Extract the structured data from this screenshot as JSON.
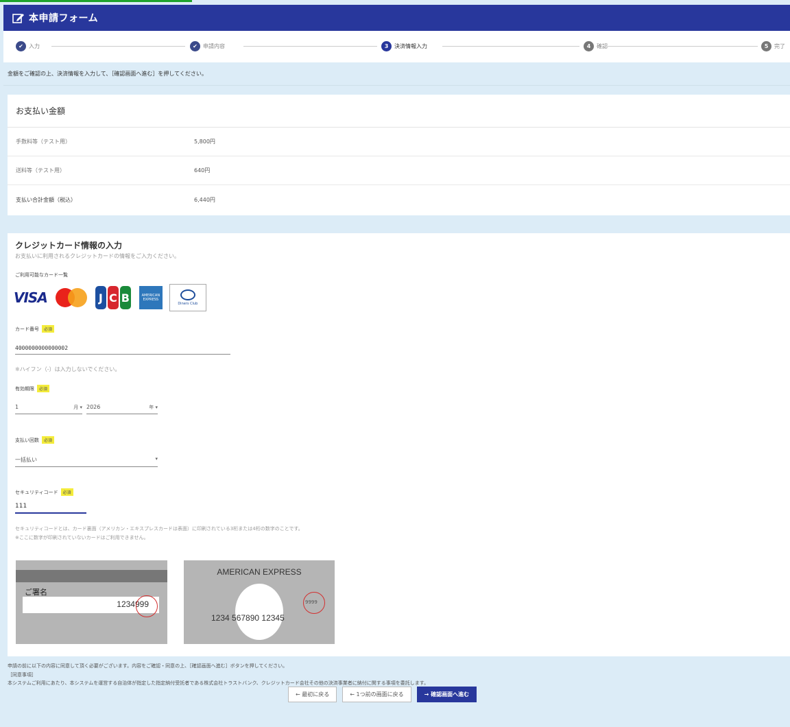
{
  "header": {
    "title": "本申請フォーム",
    "icon": "edit-icon"
  },
  "stepper": {
    "steps": [
      {
        "label": "入力",
        "state": "done"
      },
      {
        "label": "申請内容",
        "state": "done"
      },
      {
        "label": "決済情報入力",
        "state": "active",
        "number": "3"
      },
      {
        "label": "確認",
        "state": "todo",
        "number": "4"
      },
      {
        "label": "完了",
        "state": "todo",
        "number": "5"
      }
    ]
  },
  "notice": "金額をご確認の上、決済情報を入力して、［確認画面へ進む］を押してください。",
  "payment": {
    "title": "お支払い金額",
    "rows": [
      {
        "key": "手数料等（テスト用）",
        "value": "5,800円"
      },
      {
        "key": "送料等（テスト用）",
        "value": "640円"
      },
      {
        "key": "支払い合計金額（税込）",
        "value": "6,440円"
      }
    ]
  },
  "credit": {
    "title": "クレジットカード情報の入力",
    "subtitle": "お支払いに利用されるクレジットカードの情報をご入力ください。",
    "brands_label": "ご利用可能なカード一覧",
    "brands": {
      "visa": "VISA",
      "jcb": "JCB",
      "amex_line1": "AMERICAN",
      "amex_line2": "EXPRESS",
      "diners": "Diners Club"
    },
    "card_number": {
      "label": "カード番号",
      "value": "4000000000000002",
      "hint": "※ハイフン（-）は入力しないでください。"
    },
    "expiry": {
      "label": "有効期限",
      "month": "1",
      "month_unit": "月",
      "year": "2026",
      "year_unit": "年"
    },
    "installments": {
      "label": "支払い回数",
      "value": "一括払い"
    },
    "security": {
      "label": "セキュリティコード",
      "value": "111",
      "desc1": "セキュリティコードとは、カード裏面（アメリカン・エキスプレスカードは表面）に印刷されている3桁または4桁の数字のことです。",
      "desc2": "※ここに数字が印刷されていないカードはご利用できません。"
    },
    "required": "必須",
    "card_back": {
      "sign": "ご署名",
      "number": "1234",
      "code": "999"
    },
    "card_amex": {
      "brand": "AMERICAN EXPRESS",
      "cvv": "9999",
      "number": "1234 567890 12345"
    }
  },
  "footer": {
    "line1": "申請の前に以下の内容に同意して頂く必要がございます。内容をご確認・同意の上、［確認画面へ進む］ボタンを押してください。",
    "line2": "［同意事項］",
    "line3": "本システムご利用にあたり、本システムを運営する自治体が指定した指定納付受託者である株式会社トラストバンク、クレジットカード会社その他の決済事業者に納付に関する事項を委託します。"
  },
  "buttons": {
    "first": "最初に戻る",
    "back": "1つ前の画面に戻る",
    "next": "確認画面へ進む"
  }
}
